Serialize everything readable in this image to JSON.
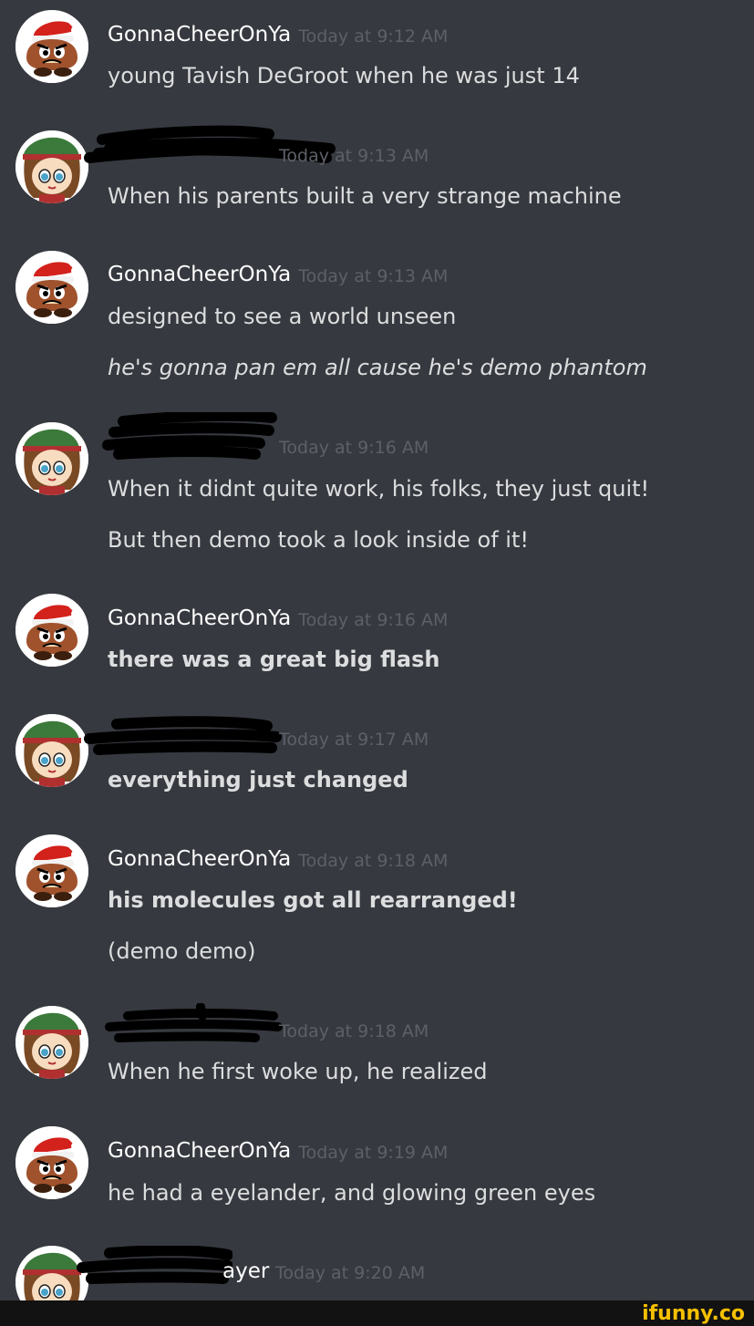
{
  "messages": [
    {
      "author": "GonnaCheerOnYa",
      "avatar": "goomba-santa-avatar",
      "time": "Today at 9:12 AM",
      "lines": [
        {
          "text": "young Tavish DeGroot when he was just 14",
          "style": "normal"
        }
      ]
    },
    {
      "author": "",
      "avatar": "girl-green-hat-avatar",
      "time": "Today at 9:13 AM",
      "redacted": true,
      "lines": [
        {
          "text": "When his parents built a very strange machine",
          "style": "normal"
        }
      ]
    },
    {
      "author": "GonnaCheerOnYa",
      "avatar": "goomba-santa-avatar",
      "time": "Today at 9:13 AM",
      "lines": [
        {
          "text": "designed to see a world unseen",
          "style": "normal"
        },
        {
          "text": "he's gonna pan em all cause he's demo phantom",
          "style": "italic"
        }
      ]
    },
    {
      "author": "",
      "avatar": "girl-green-hat-avatar",
      "time": "Today at 9:16 AM",
      "redacted": true,
      "lines": [
        {
          "text": "When it didnt quite work, his folks, they just quit!",
          "style": "normal"
        },
        {
          "text": "But then demo took a look inside of it!",
          "style": "normal"
        }
      ]
    },
    {
      "author": "GonnaCheerOnYa",
      "avatar": "goomba-santa-avatar",
      "time": "Today at 9:16 AM",
      "lines": [
        {
          "text": "there was a great big flash",
          "style": "bold"
        }
      ]
    },
    {
      "author": "",
      "avatar": "girl-green-hat-avatar",
      "time": "Today at 9:17 AM",
      "redacted": true,
      "lines": [
        {
          "text": "everything just changed",
          "style": "bold"
        }
      ]
    },
    {
      "author": "GonnaCheerOnYa",
      "avatar": "goomba-santa-avatar",
      "time": "Today at 9:18 AM",
      "lines": [
        {
          "text": "his molecules got all rearranged!",
          "style": "bold"
        },
        {
          "text": "(demo demo)",
          "style": "normal"
        }
      ]
    },
    {
      "author": "",
      "avatar": "girl-green-hat-avatar",
      "time": "Today at 9:18 AM",
      "redacted": true,
      "lines": [
        {
          "text": "When he first woke up, he realized",
          "style": "normal"
        }
      ]
    },
    {
      "author": "GonnaCheerOnYa",
      "avatar": "goomba-santa-avatar",
      "time": "Today at 9:19 AM",
      "lines": [
        {
          "text": "he had a eyelander, and glowing green eyes",
          "style": "normal"
        }
      ]
    },
    {
      "author": "ayer",
      "avatar": "girl-green-hat-avatar",
      "time": "Today at 9:20 AM",
      "redacted": true,
      "lines": []
    }
  ],
  "watermark": "ifunny.co",
  "colors": {
    "background": "#36393f",
    "username": "#ffffff",
    "timestamp": "#5d6068",
    "text": "#dcddde",
    "redaction": "#000000"
  }
}
